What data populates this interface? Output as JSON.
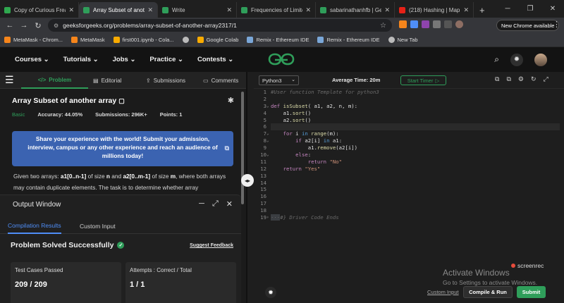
{
  "browser": {
    "tabs": [
      {
        "title": "Copy of Curious Freaks",
        "color": "#2fa84f",
        "active": false
      },
      {
        "title": "Array Subset of another",
        "color": "#2f9e5a",
        "active": true
      },
      {
        "title": "Write",
        "color": "#2f9e5a",
        "active": false
      },
      {
        "title": "Frequencies of Limited",
        "color": "#2f9e5a",
        "active": false
      },
      {
        "title": "sabarinathanhfb | Geeks",
        "color": "#2f9e5a",
        "active": false
      },
      {
        "title": "(218) Hashing | Map",
        "color": "#e62117",
        "active": false
      }
    ],
    "url": "geeksforgeeks.org/problems/array-subset-of-another-array2317/1",
    "new_chrome_label": "New Chrome available",
    "bookmarks": [
      {
        "label": "MetaMask - Chrom...",
        "color": "#f6851b"
      },
      {
        "label": "MetaMask",
        "color": "#f6851b"
      },
      {
        "label": "first001.ipynb - Cola...",
        "color": "#f9ab00"
      },
      {
        "label": "",
        "color": "#bbbbbb"
      },
      {
        "label": "Google Colab",
        "color": "#f9ab00"
      },
      {
        "label": "Remix - Ethereum IDE",
        "color": "#7aa7d8"
      },
      {
        "label": "Remix - Ethereum IDE",
        "color": "#7aa7d8"
      },
      {
        "label": "New Tab",
        "color": "#bbbbbb"
      }
    ]
  },
  "nav": {
    "items": [
      "Courses ⌄",
      "Tutorials ⌄",
      "Jobs ⌄",
      "Practice ⌄",
      "Contests ⌄"
    ]
  },
  "left": {
    "tabs": {
      "problem": "Problem",
      "editorial": "Editorial",
      "submissions": "Submissions",
      "comments": "Comments"
    },
    "title": "Array Subset of another array",
    "difficulty": "Basic",
    "accuracy": "Accuracy: 44.05%",
    "submissions": "Submissions: 296K+",
    "points": "Points: 1",
    "share_text": "Share your experience with the world! Submit your admission, interview, campus or any other experience and reach an audience of millions today!",
    "desc_1": "Given two arrays: ",
    "desc_a1": "a1[0..n-1]",
    "desc_2": " of size ",
    "desc_n": "n",
    "desc_3": " and ",
    "desc_a2": "a2[0..m-1]",
    "desc_4": " of size ",
    "desc_m": "m",
    "desc_5": ", where both arrays may contain duplicate elements. The task is to determine whether array"
  },
  "output": {
    "title": "Output Window",
    "tab_results": "Compilation Results",
    "tab_custom": "Custom Input",
    "status": "Problem Solved Successfully",
    "feedback": "Suggest Feedback",
    "testcases_label": "Test Cases Passed",
    "testcases_value": "209 / 209",
    "attempts_label": "Attempts : Correct / Total",
    "attempts_value": "1 / 1"
  },
  "editor": {
    "language": "Python3",
    "avg_time": "Average Time: 20m",
    "timer": "Start Timer",
    "custom_input": "Custom Input",
    "compile_run": "Compile & Run",
    "submit": "Submit"
  },
  "code_lines": [
    "#User function Template for python3",
    "",
    "def isSubset( a1, a2, n, m):",
    "    a1.sort()",
    "    a2.sort()",
    "    ",
    "    for i in range(m):",
    "        if a2[i] in a1:",
    "            a1.remove(a2[i])",
    "        else:",
    "            return \"No\"",
    "    return \"Yes\"",
    "",
    "",
    "",
    "",
    "",
    "",
    "#} Driver Code Ends"
  ],
  "overlay": {
    "activate_title": "Activate Windows",
    "activate_sub": "Go to Settings to activate Windows.",
    "screenrec": "screenrec"
  }
}
